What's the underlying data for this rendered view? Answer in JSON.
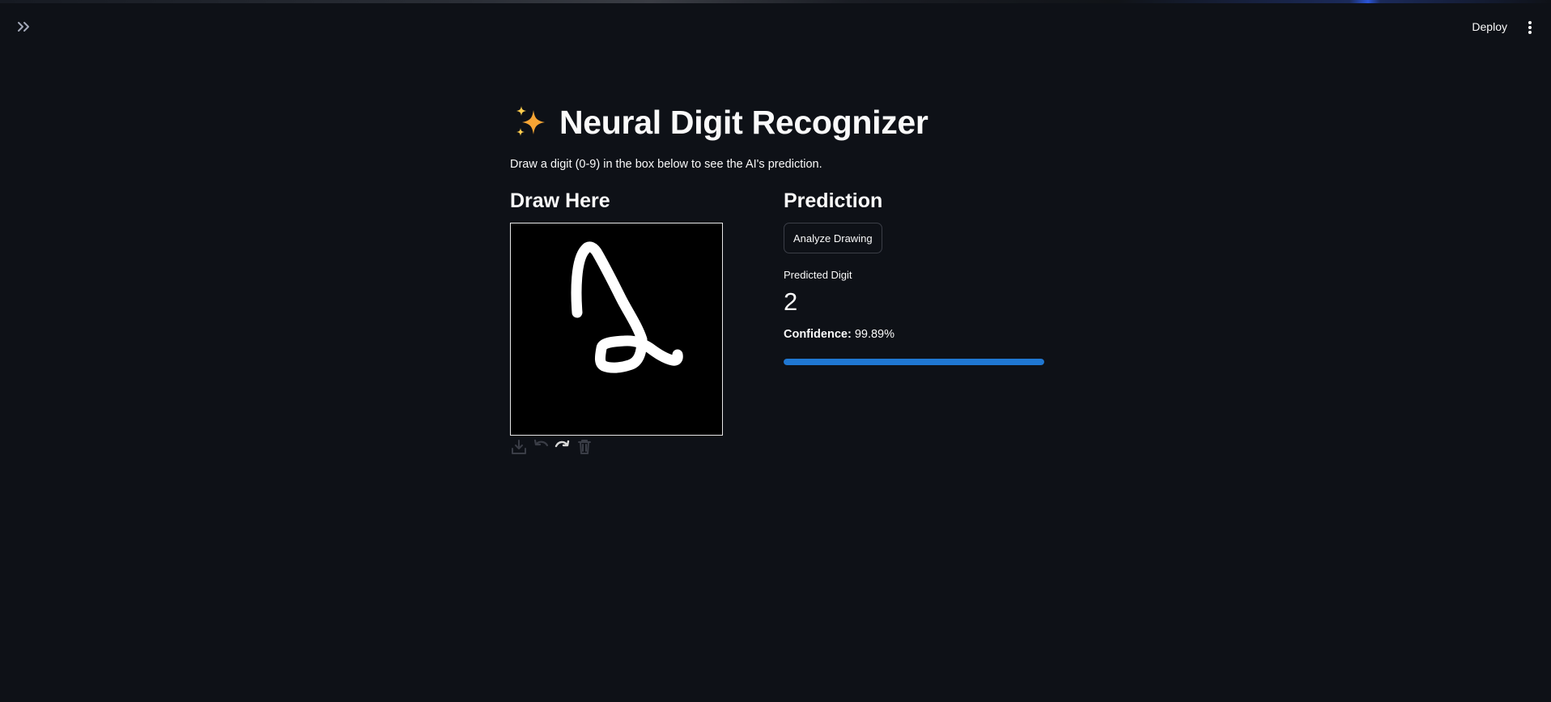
{
  "toolbar": {
    "deploy_label": "Deploy",
    "sidebar_toggle_icon": "double-chevron-right-icon",
    "menu_icon": "vertical-ellipsis-icon"
  },
  "header": {
    "title_icon": "sparkles-icon",
    "title": "Neural Digit Recognizer",
    "subtitle": "Draw a digit (0-9) in the box below to see the AI's prediction."
  },
  "draw_panel": {
    "heading": "Draw Here",
    "canvas_background": "#000000",
    "stroke_color": "#ffffff",
    "tools": [
      "download-icon",
      "undo-icon",
      "redo-icon",
      "trash-icon"
    ]
  },
  "prediction_panel": {
    "heading": "Prediction",
    "analyze_label": "Analyze Drawing",
    "metric_label": "Predicted Digit",
    "predicted_digit": "2",
    "confidence_label": "Confidence:",
    "confidence_value": "99.89%",
    "progress_percent": 99.89,
    "progress_color": "#1f77d2"
  }
}
